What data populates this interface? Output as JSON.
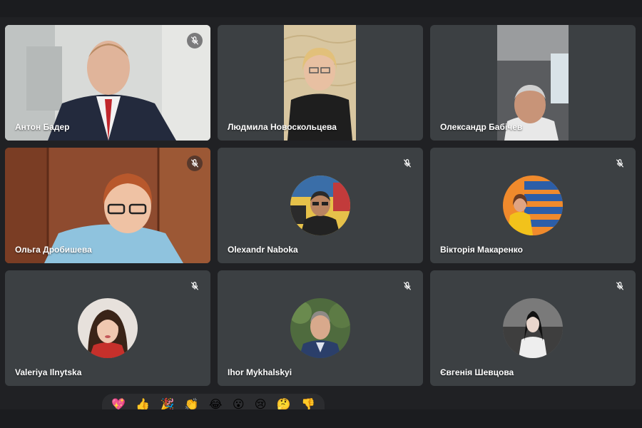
{
  "participants": [
    {
      "name": "Антон Бадер"
    },
    {
      "name": "Людмила Новоскольцева"
    },
    {
      "name": "Олександр Бабічев"
    },
    {
      "name": "Ольга Дробишева"
    },
    {
      "name": "Olexandr Naboka"
    },
    {
      "name": "Вікторія Макаренко"
    },
    {
      "name": "Valeriya Ilnytska"
    },
    {
      "name": "Ihor Mykhalskyi"
    },
    {
      "name": "Євгенія Шевцова"
    }
  ],
  "reactions": [
    {
      "glyph": "💖",
      "icon": "sparkling-heart-icon"
    },
    {
      "glyph": "👍",
      "icon": "thumbs-up-icon"
    },
    {
      "glyph": "🎉",
      "icon": "party-popper-icon"
    },
    {
      "glyph": "👏",
      "icon": "clapping-hands-icon"
    },
    {
      "glyph": "😂",
      "icon": "tears-of-joy-icon"
    },
    {
      "glyph": "😮",
      "icon": "surprised-face-icon"
    },
    {
      "glyph": "😢",
      "icon": "crying-face-icon"
    },
    {
      "glyph": "🤔",
      "icon": "thinking-face-icon"
    },
    {
      "glyph": "👎",
      "icon": "thumbs-down-icon"
    }
  ],
  "colors": {
    "background": "#202124",
    "tile": "#3c4043",
    "name_text": "#ffffff"
  }
}
